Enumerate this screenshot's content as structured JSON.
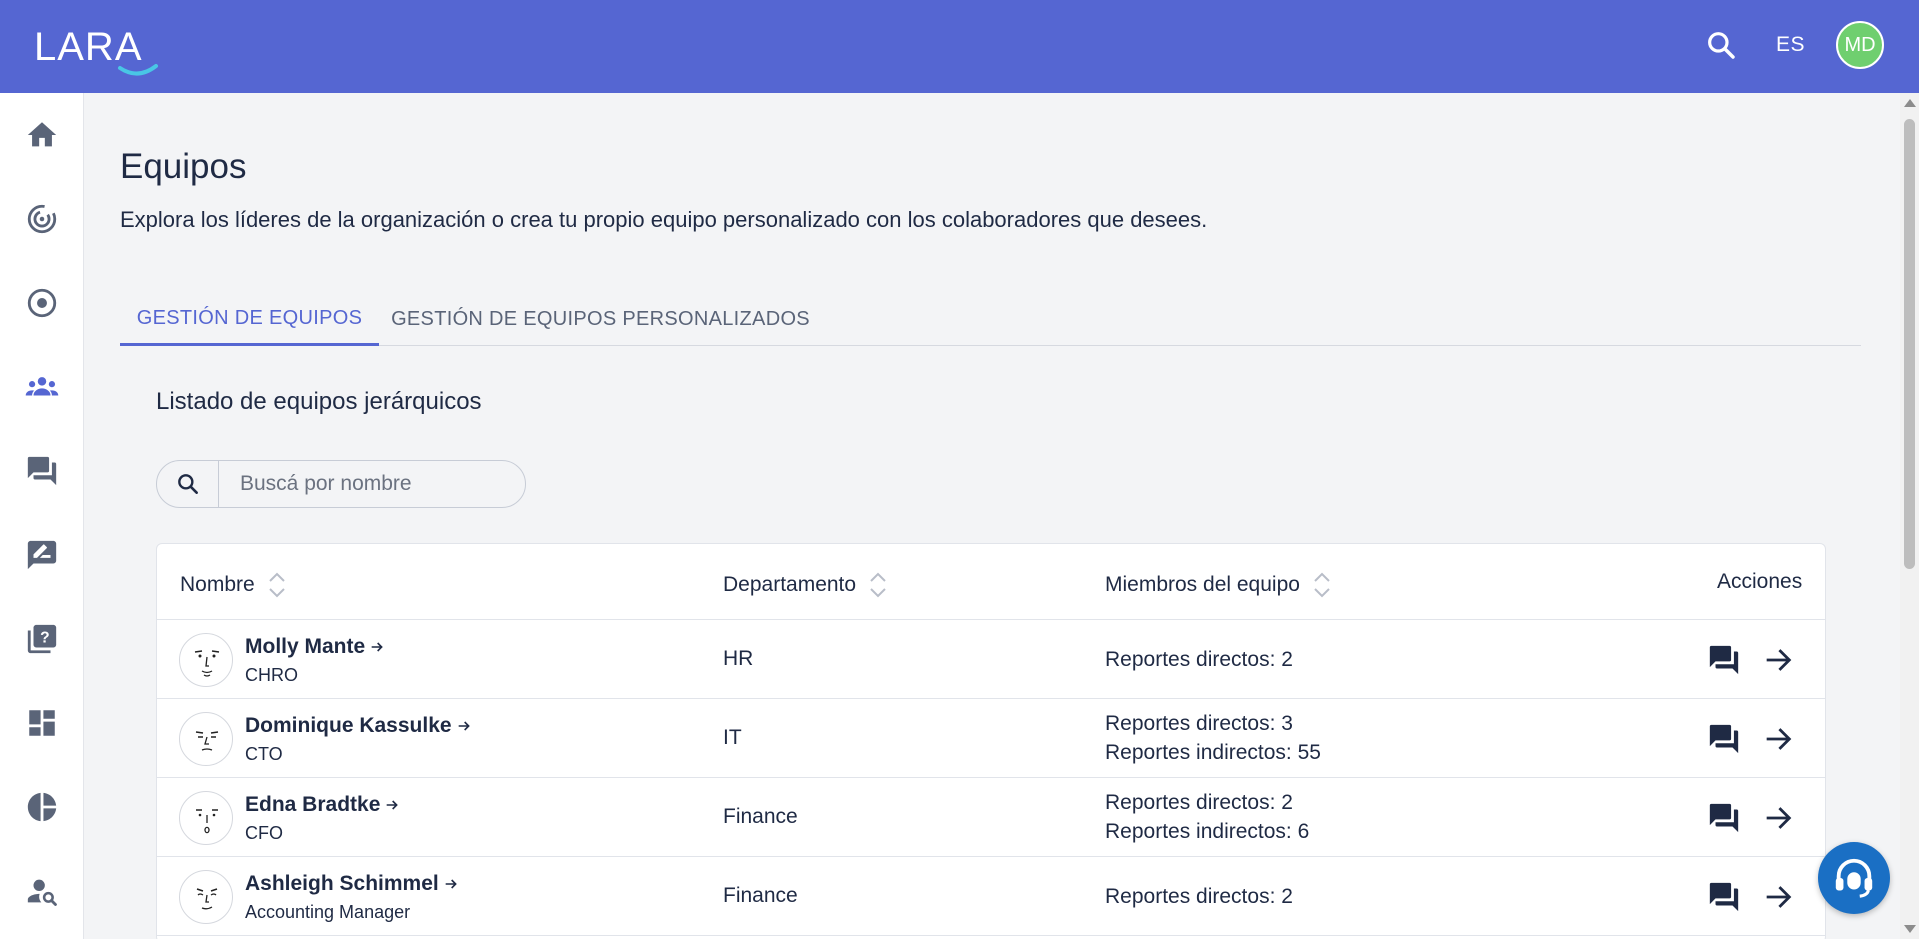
{
  "app": {
    "logo_text": "LARA",
    "brand_color": "#5566d2"
  },
  "topbar": {
    "search_icon": "search-icon",
    "language": "ES",
    "avatar_initials": "MD",
    "avatar_color": "#6fcf6f"
  },
  "sidebar": {
    "items": [
      {
        "icon": "home-icon"
      },
      {
        "icon": "target-fingerprint-icon"
      },
      {
        "icon": "radio-target-icon"
      },
      {
        "icon": "groups-icon",
        "active": true
      },
      {
        "icon": "forum-icon"
      },
      {
        "icon": "rate-review-icon"
      },
      {
        "icon": "quiz-icon"
      },
      {
        "icon": "dashboard-icon"
      },
      {
        "icon": "pie-chart-icon"
      },
      {
        "icon": "person-search-icon"
      }
    ]
  },
  "page": {
    "title": "Equipos",
    "subtitle": "Explora los líderes de la organización o crea tu propio equipo personalizado con los colaboradores que desees."
  },
  "tabs": [
    {
      "label": "GESTIÓN DE EQUIPOS",
      "active": true
    },
    {
      "label": "GESTIÓN DE EQUIPOS PERSONALIZADOS",
      "active": false
    }
  ],
  "section": {
    "title": "Listado de equipos jerárquicos",
    "search_placeholder": "Buscá por nombre"
  },
  "table": {
    "columns": {
      "name": "Nombre",
      "department": "Departamento",
      "members": "Miembros del equipo",
      "actions": "Acciones"
    },
    "rows": [
      {
        "name": "Molly Mante",
        "role": "CHRO",
        "department": "HR",
        "direct": "Reportes directos: 2",
        "indirect": ""
      },
      {
        "name": "Dominique Kassulke",
        "role": "CTO",
        "department": "IT",
        "direct": "Reportes directos: 3",
        "indirect": "Reportes indirectos: 55"
      },
      {
        "name": "Edna Bradtke",
        "role": "CFO",
        "department": "Finance",
        "direct": "Reportes directos: 2",
        "indirect": "Reportes indirectos: 6"
      },
      {
        "name": "Ashleigh Schimmel",
        "role": "Accounting Manager",
        "department": "Finance",
        "direct": "Reportes directos: 2",
        "indirect": ""
      }
    ]
  }
}
